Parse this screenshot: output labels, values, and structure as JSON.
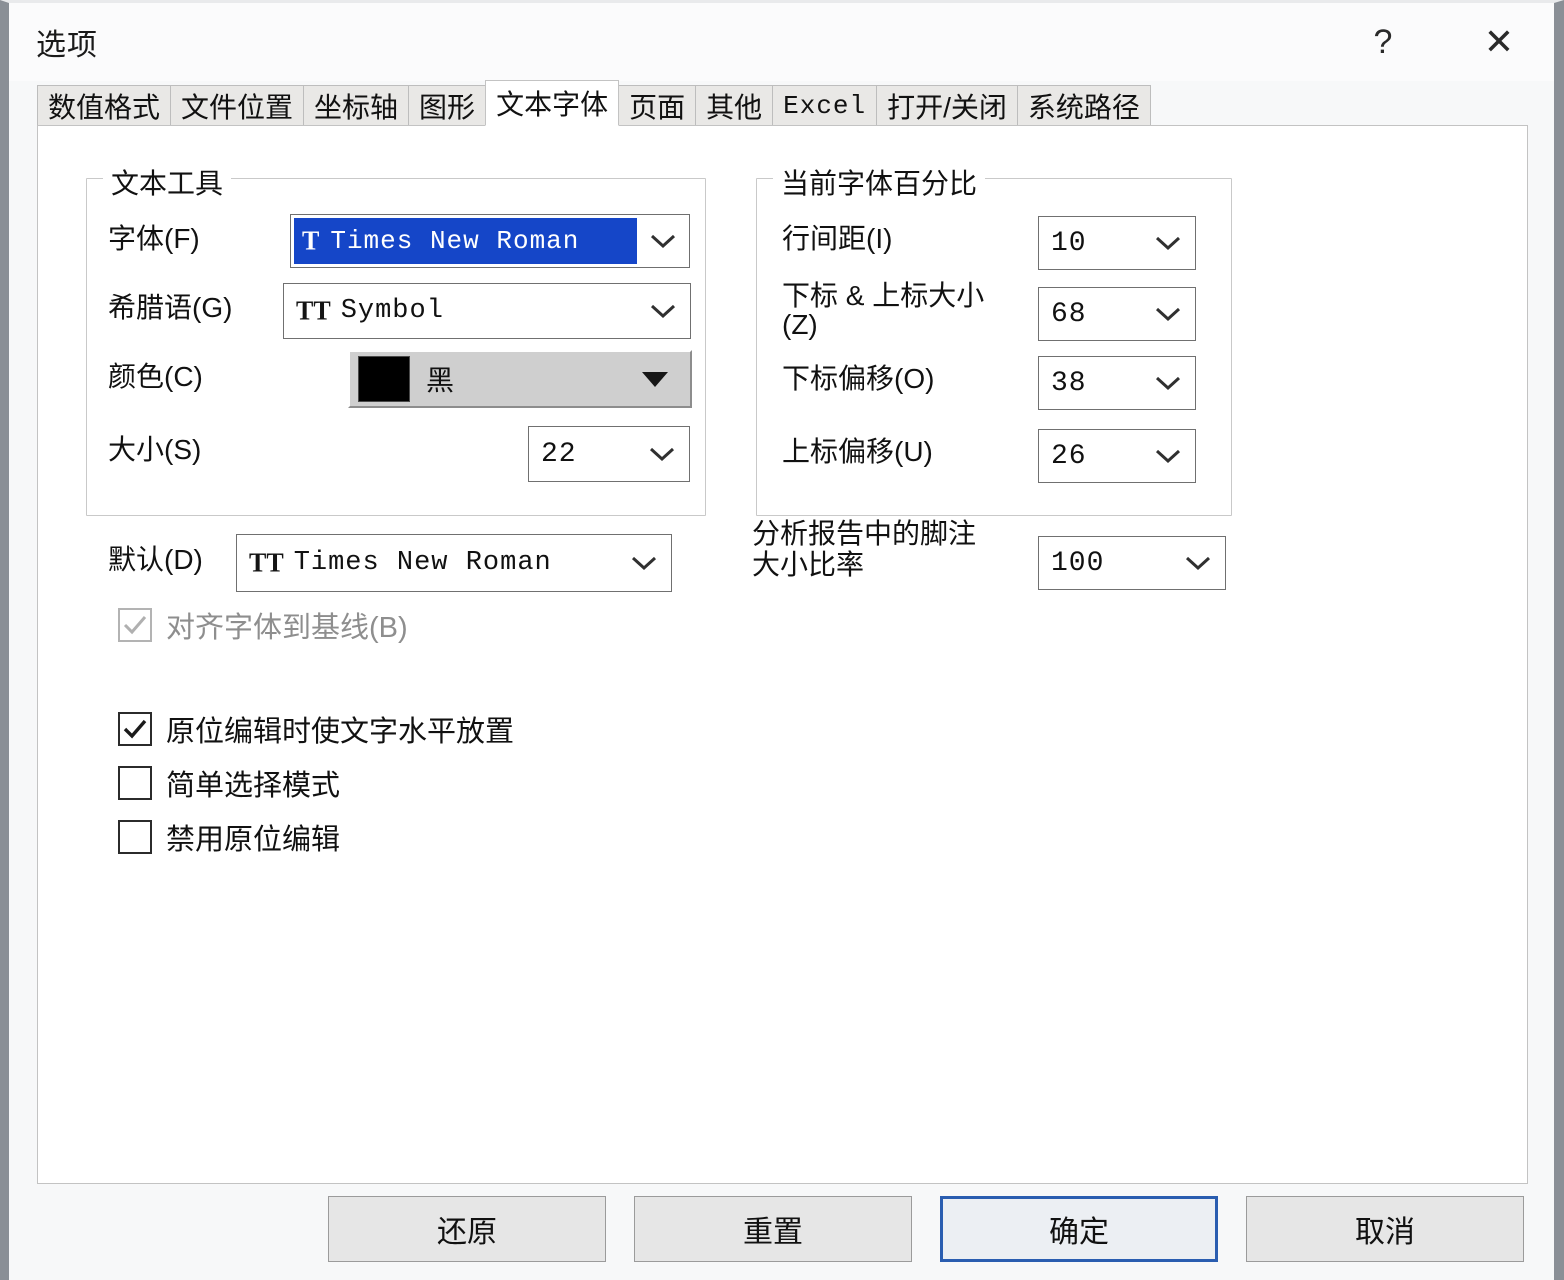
{
  "window": {
    "title": "选项",
    "help_icon": "question-mark-icon",
    "help_label": "?",
    "close_label": "✕"
  },
  "tabs": [
    {
      "label": "数值格式",
      "active": false
    },
    {
      "label": "文件位置",
      "active": false
    },
    {
      "label": "坐标轴",
      "active": false
    },
    {
      "label": "图形",
      "active": false
    },
    {
      "label": "文本字体",
      "active": true
    },
    {
      "label": "页面",
      "active": false
    },
    {
      "label": "其他",
      "active": false
    },
    {
      "label": "Excel",
      "active": false
    },
    {
      "label": "打开/关闭",
      "active": false
    },
    {
      "label": "系统路径",
      "active": false
    }
  ],
  "text_tools": {
    "group_title": "文本工具",
    "font": {
      "label": "字体(F)",
      "value": "Times New Roman",
      "icon": "truetype-icon",
      "icon_glyph": "T",
      "selected": true,
      "highlight_color": "#1546c8"
    },
    "greek": {
      "label": "希腊语(G)",
      "value": "Symbol",
      "icon": "truetype-icon",
      "icon_glyph": "TT"
    },
    "color": {
      "label": "颜色(C)",
      "value": "黑",
      "swatch_color": "#000000"
    },
    "size": {
      "label": "大小(S)",
      "value": "22"
    }
  },
  "font_percent": {
    "group_title": "当前字体百分比",
    "rows": [
      {
        "label": "行间距(I)",
        "value": "10"
      },
      {
        "label": "下标 & 上标大小\n(Z)",
        "value": "68"
      },
      {
        "label": "下标偏移(O)",
        "value": "38"
      },
      {
        "label": "上标偏移(U)",
        "value": "26"
      }
    ]
  },
  "defaults": {
    "label": "默认(D)",
    "value": "Times New Roman",
    "icon": "truetype-icon",
    "icon_glyph": "TT"
  },
  "footnote": {
    "label": "分析报告中的脚注\n大小比率",
    "value": "100"
  },
  "checkboxes": [
    {
      "label": "对齐字体到基线(B)",
      "checked": true,
      "disabled": true
    },
    {
      "label": "原位编辑时使文字水平放置",
      "checked": true,
      "disabled": false
    },
    {
      "label": "简单选择模式",
      "checked": false,
      "disabled": false
    },
    {
      "label": "禁用原位编辑",
      "checked": false,
      "disabled": false
    }
  ],
  "buttons": [
    {
      "label": "还原",
      "default": false
    },
    {
      "label": "重置",
      "default": false
    },
    {
      "label": "确定",
      "default": true
    },
    {
      "label": "取消",
      "default": false
    }
  ]
}
